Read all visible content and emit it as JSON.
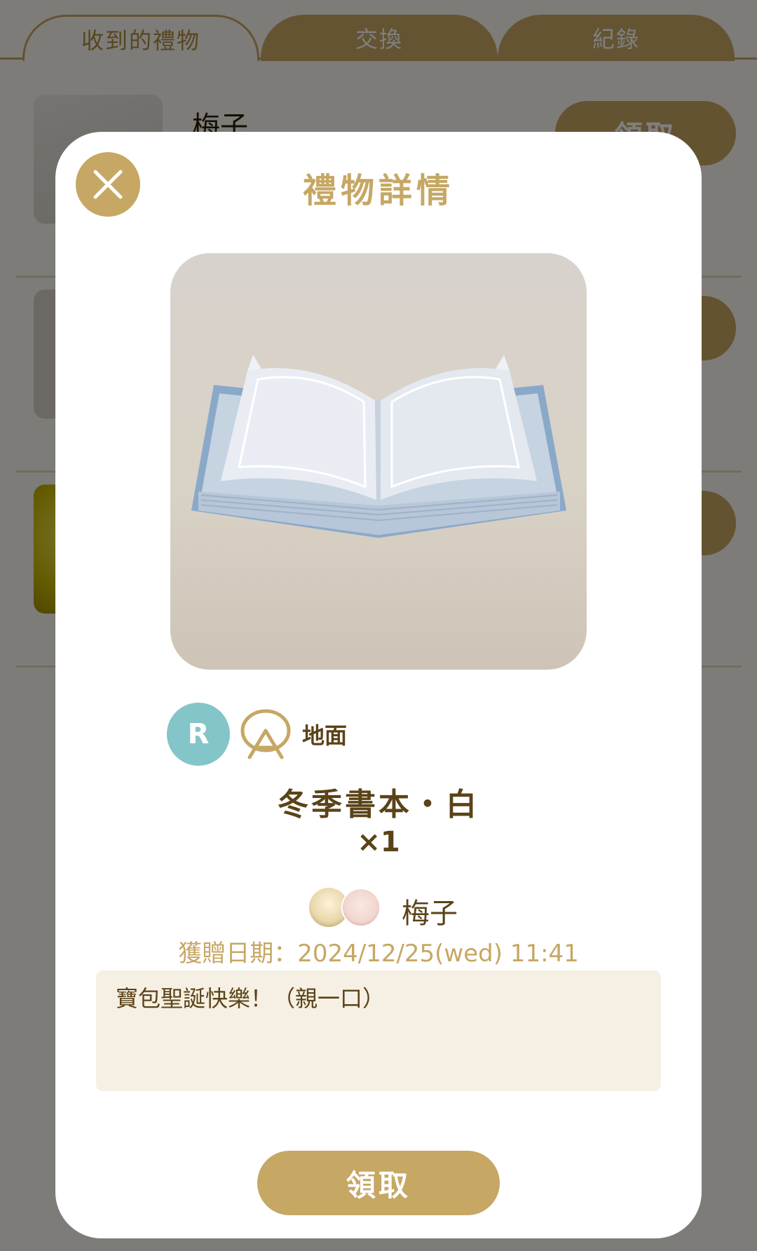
{
  "tabs": [
    {
      "label": "收到的禮物",
      "active": true
    },
    {
      "label": "交換",
      "active": false
    },
    {
      "label": "紀錄",
      "active": false
    }
  ],
  "list": {
    "rows": [
      {
        "sender": "梅子",
        "claim_label": "領取"
      },
      {
        "sender": "",
        "claim_label": ""
      },
      {
        "sender": "",
        "claim_label": ""
      }
    ]
  },
  "modal": {
    "title": "禮物詳情",
    "close_icon": "close-icon",
    "item_image_icon": "open-book-icon",
    "rarity": "R",
    "category_icon": "floor-icon",
    "category": "地面",
    "item_name": "冬季書本・白",
    "quantity": "×1",
    "sender": "梅子",
    "date": "獲贈日期：2024/12/25(wed) 11:41",
    "message": "寶包聖誕快樂！（親一口）",
    "claim_label": "領取"
  },
  "colors": {
    "accent": "#c6a763",
    "text_brown": "#5a4318",
    "rarity_r": "#83c5c8",
    "message_bg": "#f6efe3"
  }
}
